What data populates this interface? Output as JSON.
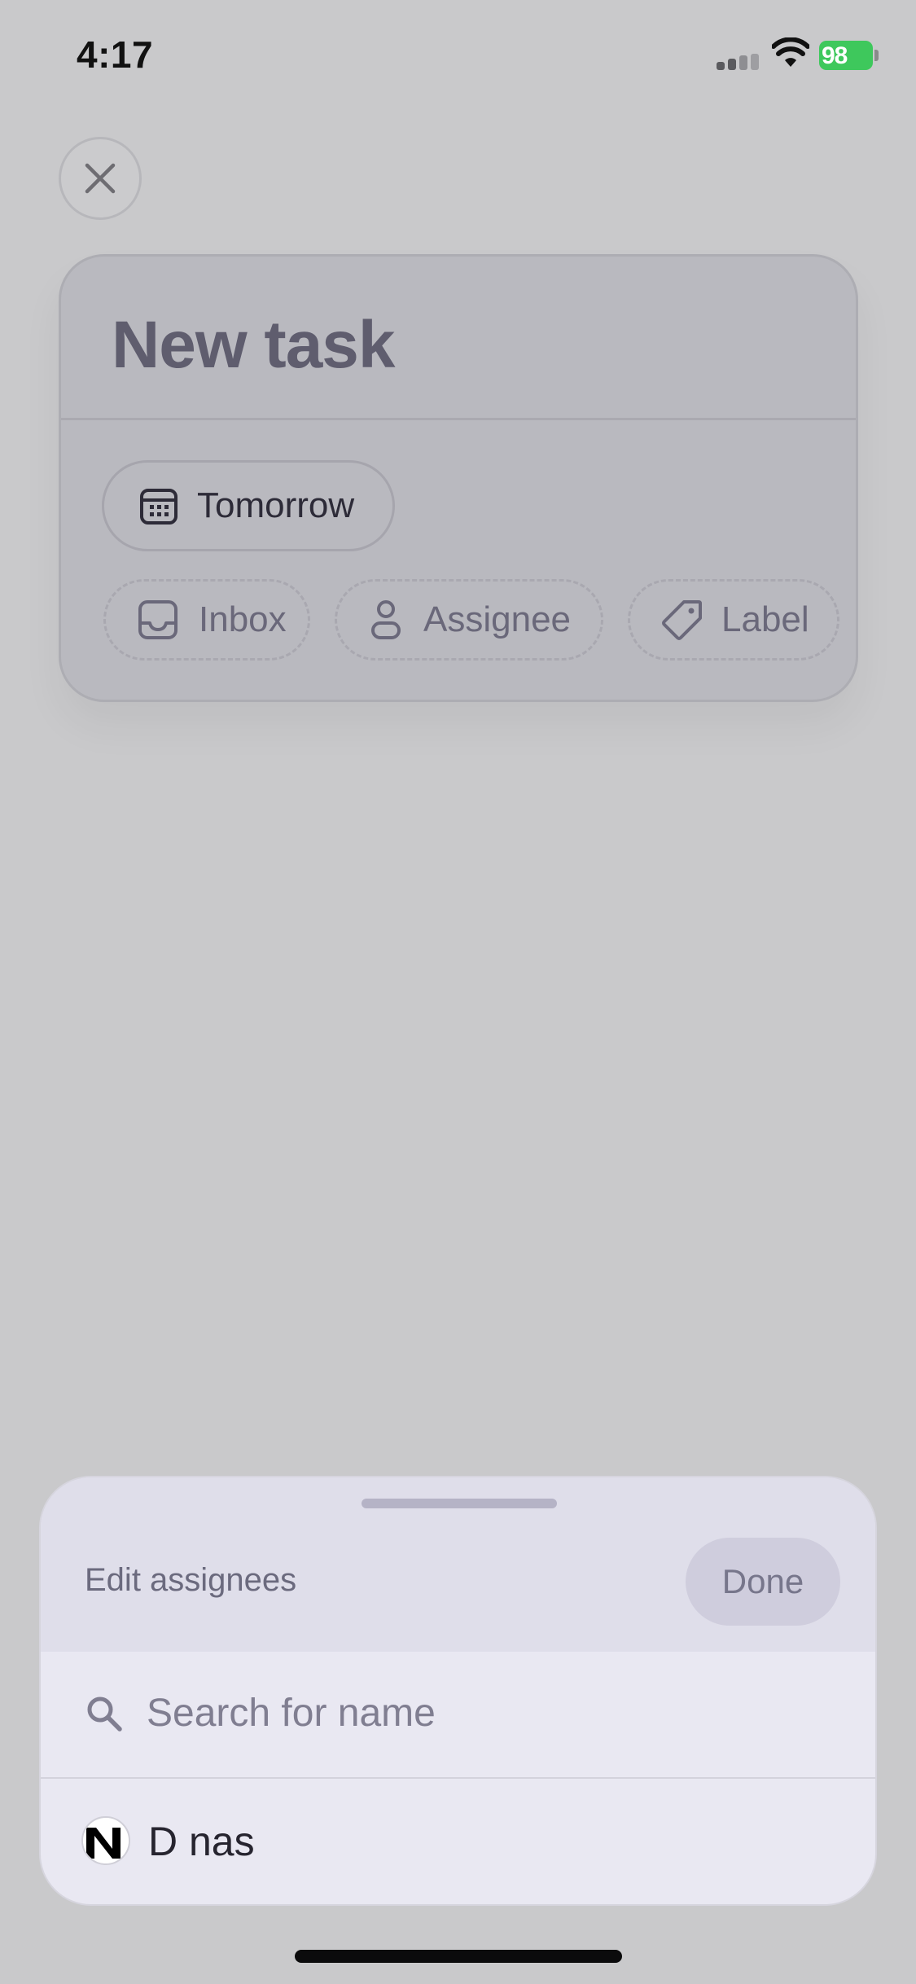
{
  "status_bar": {
    "time": "4:17",
    "battery_percent": "98"
  },
  "task": {
    "title": "New task",
    "chips": {
      "date": "Tomorrow",
      "project": "Inbox",
      "assignee": "Assignee",
      "label": "Label"
    }
  },
  "sheet": {
    "title": "Edit assignees",
    "done_label": "Done",
    "search_placeholder": "Search for name",
    "people": [
      {
        "name": "D nas"
      }
    ]
  },
  "colors": {
    "backdrop": "#c9c9cb",
    "sheet_bg": "#e9e8f2",
    "battery_green": "#3ec85c"
  }
}
